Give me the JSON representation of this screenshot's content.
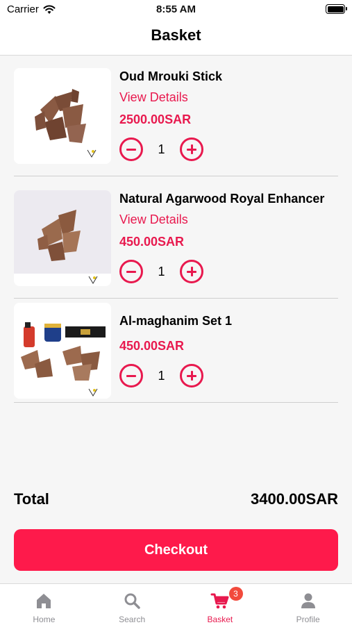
{
  "status": {
    "carrier": "Carrier",
    "time": "8:55 AM"
  },
  "header": {
    "title": "Basket"
  },
  "items": [
    {
      "name": "Oud Mrouki Stick",
      "link": "View Details",
      "price": "2500.00SAR",
      "quantity": "1"
    },
    {
      "name": "Natural Agarwood Royal Enhancer",
      "link": "View Details",
      "price": "450.00SAR",
      "quantity": "1"
    },
    {
      "name": "Al-maghanim Set 1",
      "price": "450.00SAR",
      "quantity": "1"
    }
  ],
  "summary": {
    "total_label": "Total",
    "total_value": "3400.00SAR"
  },
  "checkout_label": "Checkout",
  "tabbar": {
    "tabs": [
      {
        "label": "Home",
        "icon": "home-icon"
      },
      {
        "label": "Search",
        "icon": "search-icon"
      },
      {
        "label": "Basket",
        "icon": "cart-icon",
        "badge": "3",
        "active": true
      },
      {
        "label": "Profile",
        "icon": "profile-icon"
      }
    ]
  },
  "colors": {
    "accent": "#e8194e",
    "checkout": "#fe1a4b",
    "badge": "#f24a3c",
    "inactive": "#8e8e93"
  }
}
